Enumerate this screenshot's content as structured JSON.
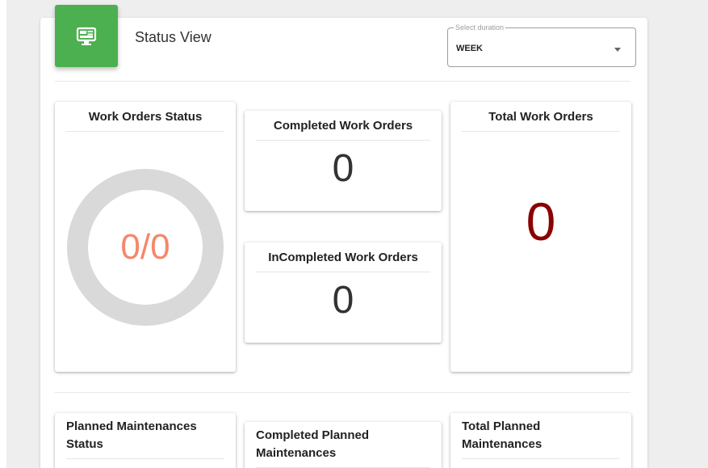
{
  "header": {
    "title": "Status View",
    "icon": "monitor-dashboard-icon",
    "accent_color": "#4caf50"
  },
  "duration": {
    "label": "Select duration",
    "value": "WEEK"
  },
  "work_orders": {
    "status_title": "Work Orders Status",
    "status_value": "0/0",
    "completed_title": "Completed Work Orders",
    "completed_value": "0",
    "incompleted_title": "InCompleted Work Orders",
    "incompleted_value": "0",
    "total_title": "Total Work Orders",
    "total_value": "0",
    "status_color": "#f4876a",
    "total_color": "#8b0000"
  },
  "planned_maintenances": {
    "status_title": "Planned Maintenances Status",
    "completed_title": "Completed Planned Maintenances",
    "total_title": "Total Planned Maintenances"
  }
}
